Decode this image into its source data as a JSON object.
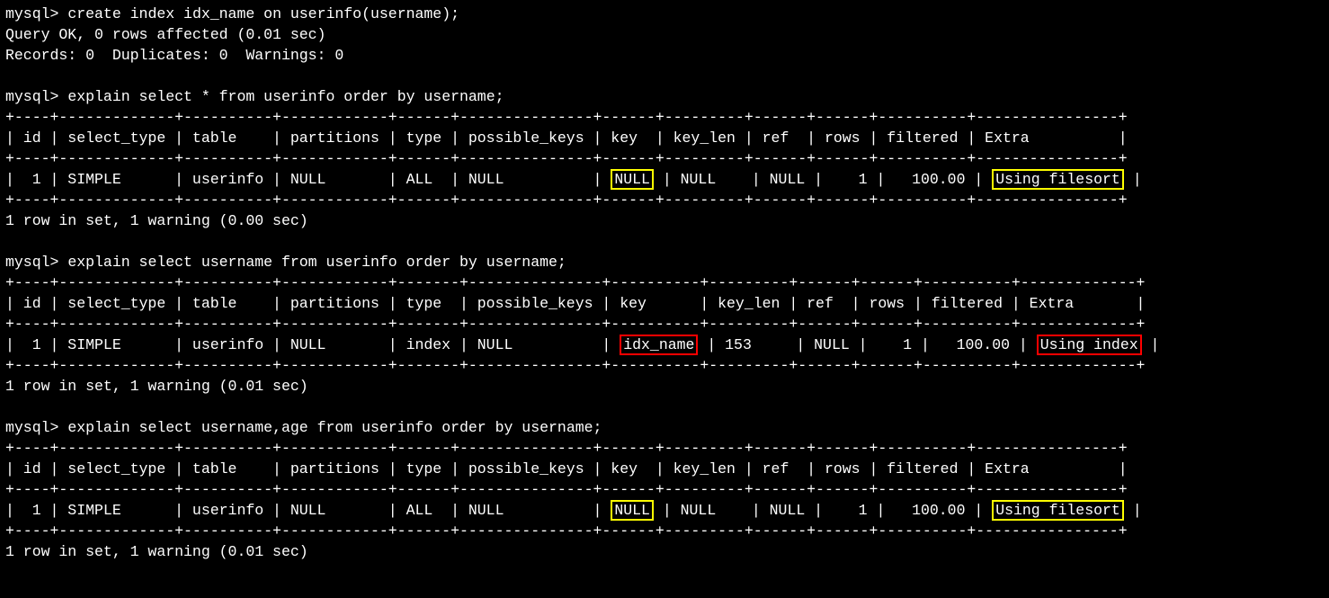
{
  "prompt": "mysql>",
  "cmd_create": "create index idx_name on userinfo(username);",
  "create_result1": "Query OK, 0 rows affected (0.01 sec)",
  "create_result2": "Records: 0  Duplicates: 0  Warnings: 0",
  "cmd_explain1": "explain select * from userinfo order by username;",
  "cmd_explain2": "explain select username from userinfo order by username;",
  "cmd_explain3": "explain select username,age from userinfo order by username;",
  "q1": {
    "border": "+----+-------------+----------+------------+------+---------------+------+---------+------+------+----------+----------------+",
    "header": "| id | select_type | table    | partitions | type | possible_keys | key  | key_len | ref  | rows | filtered | Extra          |",
    "row_a": "|  1 | SIMPLE      | userinfo | NULL       | ALL  | NULL          | ",
    "row_key": "NULL",
    "row_b": " | NULL    | NULL |    1 |   100.00 | ",
    "row_extra": "Using filesort",
    "row_c": " |",
    "timing": "1 row in set, 1 warning (0.00 sec)"
  },
  "q2": {
    "border": "+----+-------------+----------+------------+-------+---------------+----------+---------+------+------+----------+-------------+",
    "header": "| id | select_type | table    | partitions | type  | possible_keys | key      | key_len | ref  | rows | filtered | Extra       |",
    "row_a": "|  1 | SIMPLE      | userinfo | NULL       | index | NULL          | ",
    "row_key": "idx_name",
    "row_b": " | 153     | NULL |    1 |   100.00 | ",
    "row_extra": "Using index",
    "row_c": " |",
    "timing": "1 row in set, 1 warning (0.01 sec)"
  },
  "q3": {
    "border": "+----+-------------+----------+------------+------+---------------+------+---------+------+------+----------+----------------+",
    "header": "| id | select_type | table    | partitions | type | possible_keys | key  | key_len | ref  | rows | filtered | Extra          |",
    "row_a": "|  1 | SIMPLE      | userinfo | NULL       | ALL  | NULL          | ",
    "row_key": "NULL",
    "row_b": " | NULL    | NULL |    1 |   100.00 | ",
    "row_extra": "Using filesort",
    "row_c": " |",
    "timing": "1 row in set, 1 warning (0.01 sec)"
  }
}
